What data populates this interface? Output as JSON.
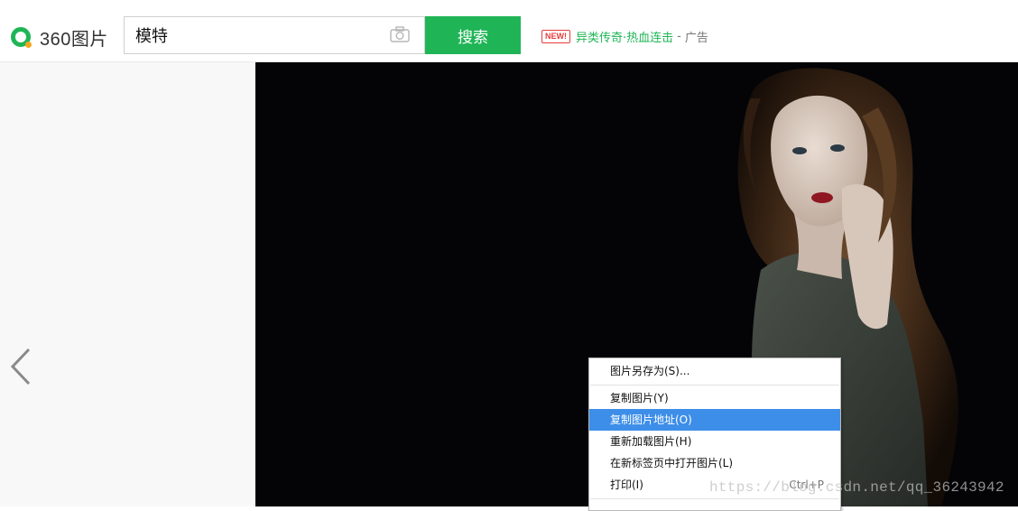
{
  "header": {
    "logo_text": "360图片",
    "search": {
      "value": "模特",
      "placeholder": ""
    },
    "search_button": "搜索",
    "ad": {
      "badge": "NEW!",
      "text": "异类传奇·热血连击",
      "separator": "-",
      "label": "广告"
    }
  },
  "icons": {
    "camera": "camera-icon",
    "prev": "chevron-left-icon"
  },
  "context_menu": {
    "items": [
      {
        "label": "图片另存为(S)...",
        "shortcut": ""
      },
      {
        "label": "复制图片(Y)",
        "shortcut": ""
      },
      {
        "label": "复制图片地址(O)",
        "shortcut": "",
        "highlighted": true
      },
      {
        "label": "重新加载图片(H)",
        "shortcut": ""
      },
      {
        "label": "在新标签页中打开图片(L)",
        "shortcut": ""
      },
      {
        "label": "打印(I)",
        "shortcut": "Ctrl+P"
      }
    ]
  },
  "watermark": "https://blog.csdn.net/qq_36243942",
  "colors": {
    "brand_green": "#1fb556",
    "highlight_blue": "#3d8ee8",
    "viewer_bg": "#040407"
  }
}
